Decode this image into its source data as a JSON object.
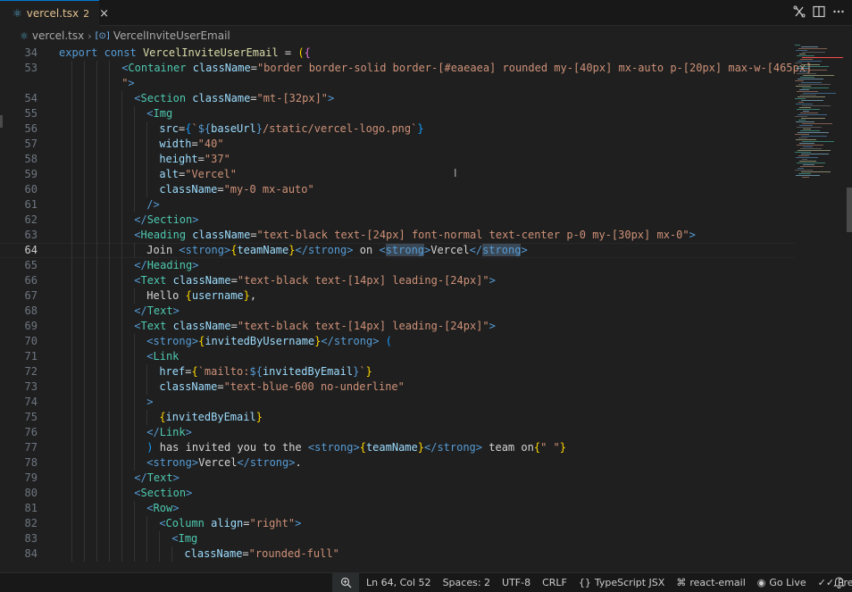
{
  "tab": {
    "icon": "typescript-react-icon",
    "title": "vercel.tsx",
    "badge": "2",
    "actions": [
      "compare-changes-icon",
      "split-editor-icon",
      "more-actions-icon"
    ]
  },
  "breadcrumb": {
    "file": "vercel.tsx",
    "symbol": "VercelInviteUserEmail"
  },
  "editor": {
    "current_line": 64,
    "lines": [
      {
        "n": "34",
        "tokens": [
          [
            "kw",
            "export"
          ],
          [
            "txt",
            " "
          ],
          [
            "kw",
            "const"
          ],
          [
            "txt",
            " "
          ],
          [
            "fn",
            "VercelInviteUserEmail"
          ],
          [
            "txt",
            " = "
          ],
          [
            "br1",
            "("
          ],
          [
            "br2",
            "{"
          ]
        ]
      },
      {
        "n": "53",
        "tokens": [
          [
            "ht",
            "<"
          ],
          [
            "tag",
            "Container"
          ],
          [
            "txt",
            " "
          ],
          [
            "attr",
            "className"
          ],
          [
            "txt",
            "="
          ],
          [
            "str",
            "\"border border-solid border-[#eaeaea] rounded my-[40px] mx-auto p-[20px] max-w-[465px]"
          ]
        ]
      },
      {
        "n": "",
        "tokens": [
          [
            "str",
            "\""
          ],
          [
            "ht",
            ">"
          ]
        ]
      },
      {
        "n": "54",
        "tokens": [
          [
            "ht",
            "<"
          ],
          [
            "tag",
            "Section"
          ],
          [
            "txt",
            " "
          ],
          [
            "attr",
            "className"
          ],
          [
            "txt",
            "="
          ],
          [
            "str",
            "\"mt-[32px]\""
          ],
          [
            "ht",
            ">"
          ]
        ]
      },
      {
        "n": "55",
        "tokens": [
          [
            "ht",
            "<"
          ],
          [
            "tag",
            "Img"
          ]
        ]
      },
      {
        "n": "56",
        "tokens": [
          [
            "attr",
            "src"
          ],
          [
            "txt",
            "="
          ],
          [
            "br3",
            "{"
          ],
          [
            "str",
            "`"
          ],
          [
            "ht",
            "${"
          ],
          [
            "var",
            "baseUrl"
          ],
          [
            "ht",
            "}"
          ],
          [
            "str",
            "/static/vercel-logo.png`"
          ],
          [
            "br3",
            "}"
          ]
        ]
      },
      {
        "n": "57",
        "tokens": [
          [
            "attr",
            "width"
          ],
          [
            "txt",
            "="
          ],
          [
            "str",
            "\"40\""
          ]
        ]
      },
      {
        "n": "58",
        "tokens": [
          [
            "attr",
            "height"
          ],
          [
            "txt",
            "="
          ],
          [
            "str",
            "\"37\""
          ]
        ]
      },
      {
        "n": "59",
        "tokens": [
          [
            "attr",
            "alt"
          ],
          [
            "txt",
            "="
          ],
          [
            "str",
            "\"Vercel\""
          ]
        ]
      },
      {
        "n": "60",
        "tokens": [
          [
            "attr",
            "className"
          ],
          [
            "txt",
            "="
          ],
          [
            "str",
            "\"my-0 mx-auto\""
          ]
        ]
      },
      {
        "n": "61",
        "tokens": [
          [
            "ht",
            "/>"
          ]
        ]
      },
      {
        "n": "62",
        "tokens": [
          [
            "ht",
            "</"
          ],
          [
            "tag",
            "Section"
          ],
          [
            "ht",
            ">"
          ]
        ]
      },
      {
        "n": "63",
        "tokens": [
          [
            "ht",
            "<"
          ],
          [
            "tag",
            "Heading"
          ],
          [
            "txt",
            " "
          ],
          [
            "attr",
            "className"
          ],
          [
            "txt",
            "="
          ],
          [
            "str",
            "\"text-black text-[24px] font-normal text-center p-0 my-[30px] mx-0\""
          ],
          [
            "ht",
            ">"
          ]
        ]
      },
      {
        "n": "64",
        "tokens": [
          [
            "txt",
            "Join "
          ],
          [
            "ht",
            "<"
          ],
          [
            "ht",
            "strong"
          ],
          [
            "ht",
            ">"
          ],
          [
            "br1",
            "{"
          ],
          [
            "var",
            "teamName"
          ],
          [
            "br1",
            "}"
          ],
          [
            "ht",
            "</"
          ],
          [
            "ht",
            "strong"
          ],
          [
            "ht",
            ">"
          ],
          [
            "txt",
            " on "
          ],
          [
            "ht",
            "<"
          ],
          [
            "hl",
            "strong"
          ],
          [
            "ht",
            ">"
          ],
          [
            "txt",
            "Vercel"
          ],
          [
            "ht",
            "</"
          ],
          [
            "hl",
            "strong"
          ],
          [
            "ht",
            ">"
          ]
        ]
      },
      {
        "n": "65",
        "tokens": [
          [
            "ht",
            "</"
          ],
          [
            "tag",
            "Heading"
          ],
          [
            "ht",
            ">"
          ]
        ]
      },
      {
        "n": "66",
        "tokens": [
          [
            "ht",
            "<"
          ],
          [
            "tag",
            "Text"
          ],
          [
            "txt",
            " "
          ],
          [
            "attr",
            "className"
          ],
          [
            "txt",
            "="
          ],
          [
            "str",
            "\"text-black text-[14px] leading-[24px]\""
          ],
          [
            "ht",
            ">"
          ]
        ]
      },
      {
        "n": "67",
        "tokens": [
          [
            "txt",
            "Hello "
          ],
          [
            "br1",
            "{"
          ],
          [
            "var",
            "username"
          ],
          [
            "br1",
            "}"
          ],
          [
            "txt",
            ","
          ]
        ]
      },
      {
        "n": "68",
        "tokens": [
          [
            "ht",
            "</"
          ],
          [
            "tag",
            "Text"
          ],
          [
            "ht",
            ">"
          ]
        ]
      },
      {
        "n": "69",
        "tokens": [
          [
            "ht",
            "<"
          ],
          [
            "tag",
            "Text"
          ],
          [
            "txt",
            " "
          ],
          [
            "attr",
            "className"
          ],
          [
            "txt",
            "="
          ],
          [
            "str",
            "\"text-black text-[14px] leading-[24px]\""
          ],
          [
            "ht",
            ">"
          ]
        ]
      },
      {
        "n": "70",
        "tokens": [
          [
            "ht",
            "<"
          ],
          [
            "ht",
            "strong"
          ],
          [
            "ht",
            ">"
          ],
          [
            "br1",
            "{"
          ],
          [
            "var",
            "invitedByUsername"
          ],
          [
            "br1",
            "}"
          ],
          [
            "ht",
            "</"
          ],
          [
            "ht",
            "strong"
          ],
          [
            "ht",
            ">"
          ],
          [
            "txt",
            " "
          ],
          [
            "br3",
            "("
          ]
        ]
      },
      {
        "n": "71",
        "tokens": [
          [
            "ht",
            "<"
          ],
          [
            "tag",
            "Link"
          ]
        ]
      },
      {
        "n": "72",
        "tokens": [
          [
            "attr",
            "href"
          ],
          [
            "txt",
            "="
          ],
          [
            "br1",
            "{"
          ],
          [
            "str",
            "`mailto:"
          ],
          [
            "ht",
            "${"
          ],
          [
            "var",
            "invitedByEmail"
          ],
          [
            "ht",
            "}"
          ],
          [
            "str",
            "`"
          ],
          [
            "br1",
            "}"
          ]
        ]
      },
      {
        "n": "73",
        "tokens": [
          [
            "attr",
            "className"
          ],
          [
            "txt",
            "="
          ],
          [
            "str",
            "\"text-blue-600 no-underline\""
          ]
        ]
      },
      {
        "n": "74",
        "tokens": [
          [
            "ht",
            ">"
          ]
        ]
      },
      {
        "n": "75",
        "tokens": [
          [
            "br1",
            "{"
          ],
          [
            "var",
            "invitedByEmail"
          ],
          [
            "br1",
            "}"
          ]
        ]
      },
      {
        "n": "76",
        "tokens": [
          [
            "ht",
            "</"
          ],
          [
            "tag",
            "Link"
          ],
          [
            "ht",
            ">"
          ]
        ]
      },
      {
        "n": "77",
        "tokens": [
          [
            "br3",
            ")"
          ],
          [
            "txt",
            " has invited you to the "
          ],
          [
            "ht",
            "<"
          ],
          [
            "ht",
            "strong"
          ],
          [
            "ht",
            ">"
          ],
          [
            "br1",
            "{"
          ],
          [
            "var",
            "teamName"
          ],
          [
            "br1",
            "}"
          ],
          [
            "ht",
            "</"
          ],
          [
            "ht",
            "strong"
          ],
          [
            "ht",
            ">"
          ],
          [
            "txt",
            " team on"
          ],
          [
            "br1",
            "{"
          ],
          [
            "str",
            "\" \""
          ],
          [
            "br1",
            "}"
          ]
        ]
      },
      {
        "n": "78",
        "tokens": [
          [
            "ht",
            "<"
          ],
          [
            "ht",
            "strong"
          ],
          [
            "ht",
            ">"
          ],
          [
            "txt",
            "Vercel"
          ],
          [
            "ht",
            "</"
          ],
          [
            "ht",
            "strong"
          ],
          [
            "ht",
            ">"
          ],
          [
            "txt",
            "."
          ]
        ]
      },
      {
        "n": "79",
        "tokens": [
          [
            "ht",
            "</"
          ],
          [
            "tag",
            "Text"
          ],
          [
            "ht",
            ">"
          ]
        ]
      },
      {
        "n": "80",
        "tokens": [
          [
            "ht",
            "<"
          ],
          [
            "tag",
            "Section"
          ],
          [
            "ht",
            ">"
          ]
        ]
      },
      {
        "n": "81",
        "tokens": [
          [
            "ht",
            "<"
          ],
          [
            "tag",
            "Row"
          ],
          [
            "ht",
            ">"
          ]
        ]
      },
      {
        "n": "82",
        "tokens": [
          [
            "ht",
            "<"
          ],
          [
            "tag",
            "Column"
          ],
          [
            "txt",
            " "
          ],
          [
            "attr",
            "align"
          ],
          [
            "txt",
            "="
          ],
          [
            "str",
            "\"right\""
          ],
          [
            "ht",
            ">"
          ]
        ]
      },
      {
        "n": "83",
        "tokens": [
          [
            "ht",
            "<"
          ],
          [
            "tag",
            "Img"
          ]
        ]
      },
      {
        "n": "84",
        "tokens": [
          [
            "attr",
            "className"
          ],
          [
            "txt",
            "="
          ],
          [
            "str",
            "\"rounded-full\""
          ]
        ]
      }
    ]
  },
  "colors": {
    "background": "#1f1f1f",
    "accent": "#0078d4",
    "modified": "#e2c08d"
  },
  "statusbar": {
    "zoom_icon": "zoom-in-icon",
    "position": "Ln 64, Col 52",
    "spaces": "Spaces: 2",
    "encoding": "UTF-8",
    "eol": "CRLF",
    "language": "TypeScript JSX",
    "extension": "react-email",
    "golive": "Go Live",
    "formatter": "Prettier",
    "bell": "bell-icon"
  }
}
